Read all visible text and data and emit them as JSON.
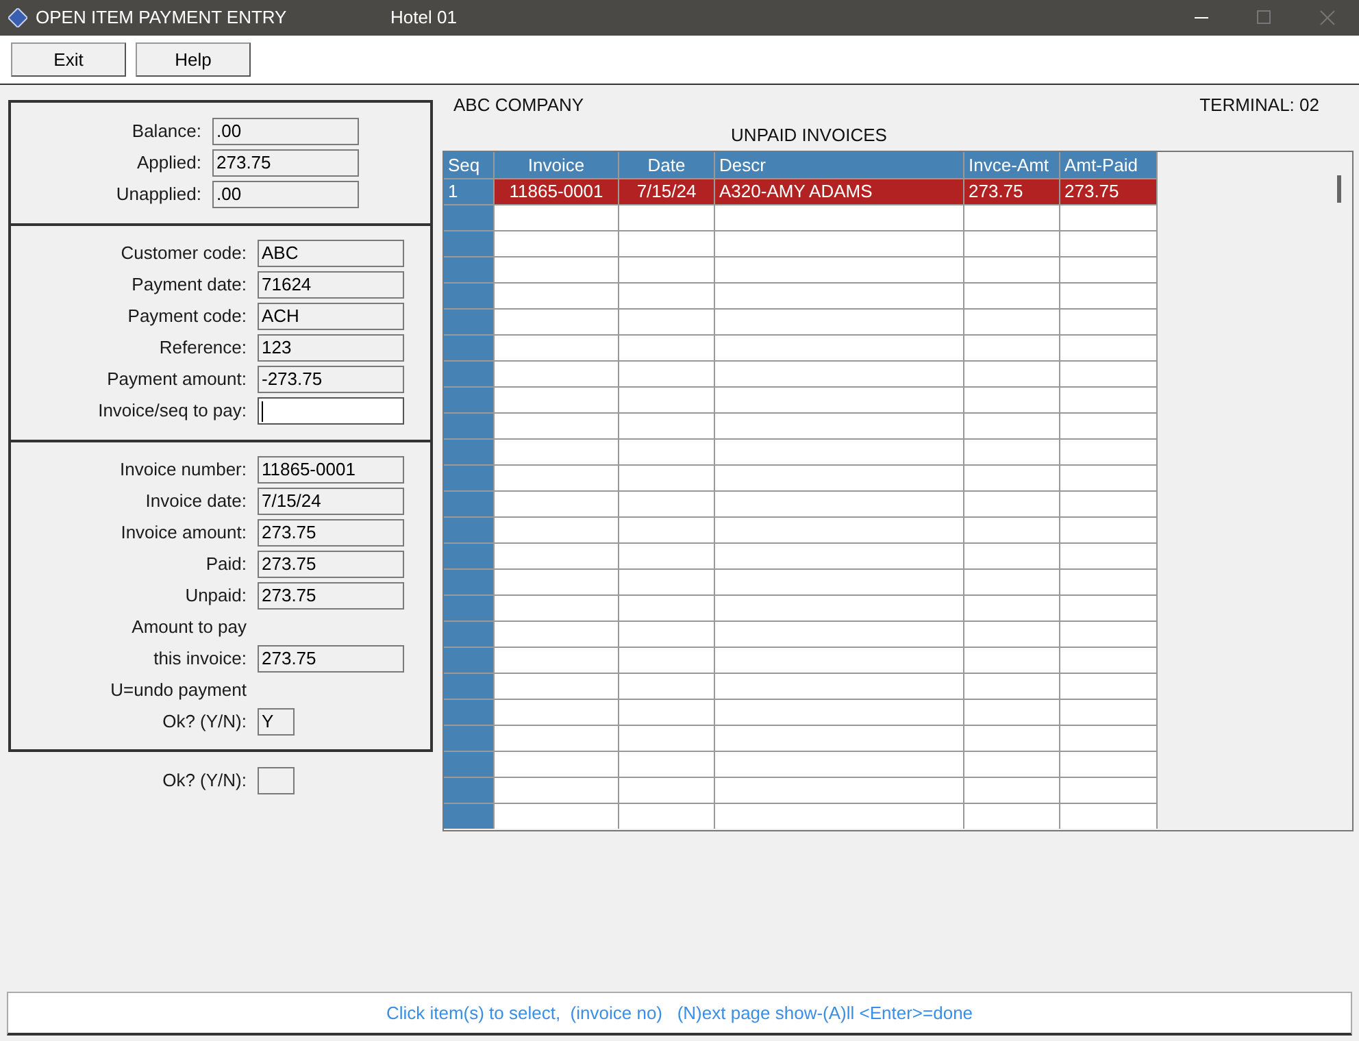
{
  "window": {
    "title": "OPEN ITEM PAYMENT ENTRY",
    "subtitle": "Hotel 01"
  },
  "toolbar": [
    "Exit",
    "Help"
  ],
  "totals": [
    {
      "label": "Balance:",
      "value": ".00"
    },
    {
      "label": "Applied:",
      "value": "273.75"
    },
    {
      "label": "Unapplied:",
      "value": ".00"
    }
  ],
  "payment": [
    {
      "label": "Customer code:",
      "value": "ABC",
      "active": false
    },
    {
      "label": "Payment date:",
      "value": "71624",
      "active": false
    },
    {
      "label": "Payment code:",
      "value": "ACH",
      "active": false
    },
    {
      "label": "Reference:",
      "value": "123",
      "active": false
    },
    {
      "label": "Payment amount:",
      "value": "-273.75",
      "active": false
    },
    {
      "label": "Invoice/seq to pay:",
      "active": true
    }
  ],
  "invoice": [
    {
      "kind": "field",
      "label": "Invoice number:",
      "value": "11865-0001"
    },
    {
      "kind": "field",
      "label": "Invoice date:",
      "value": "7/15/24"
    },
    {
      "kind": "field",
      "label": "Invoice amount:",
      "value": "273.75"
    },
    {
      "kind": "field",
      "label": "Paid:",
      "value": "273.75"
    },
    {
      "kind": "field",
      "label": "Unpaid:",
      "value": "273.75"
    },
    {
      "kind": "text",
      "label": "Amount to pay"
    },
    {
      "kind": "field",
      "label": "this invoice:",
      "value": "273.75"
    },
    {
      "kind": "text",
      "label": "U=undo payment"
    },
    {
      "kind": "small",
      "label": "Ok? (Y/N):",
      "value": "Y"
    }
  ],
  "final_prompt": {
    "label": "Ok? (Y/N):"
  },
  "company": "ABC COMPANY",
  "terminal": "TERMINAL: 02",
  "table": {
    "title": "UNPAID INVOICES",
    "columns": [
      "Seq",
      "Invoice",
      "Date",
      "Descr",
      "Invce-Amt",
      "Amt-Paid"
    ],
    "rows": [
      {
        "cells": [
          "1",
          "11865-0001",
          "7/15/24",
          "A320-AMY ADAMS",
          "273.75",
          "273.75"
        ],
        "selected": true
      }
    ]
  },
  "status_bar": "Click item(s) to select,  (invoice no)   (N)ext page show-(A)ll <Enter>=done"
}
